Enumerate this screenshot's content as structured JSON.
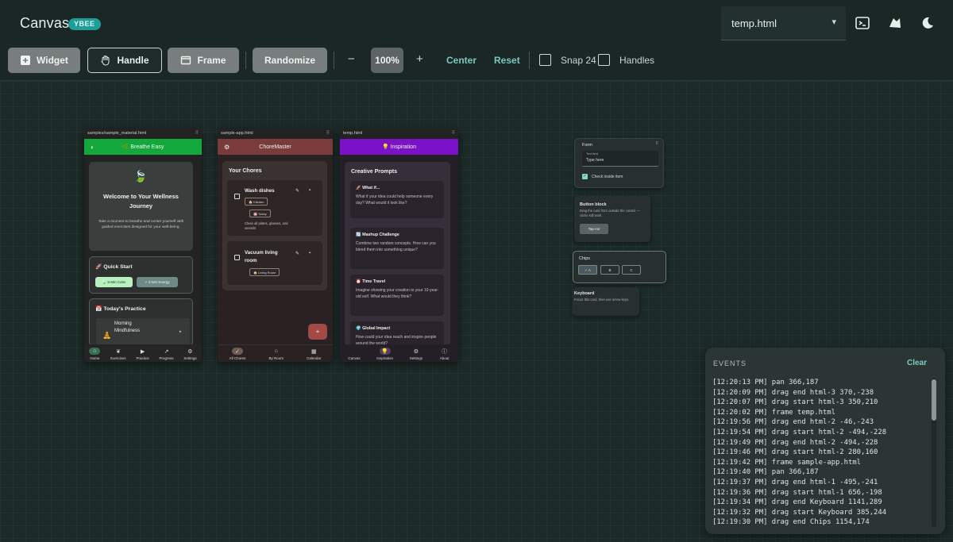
{
  "header": {
    "title": "Canvas",
    "badge": "YBEE",
    "file_select": "temp.html",
    "icons": [
      "terminal-icon",
      "shapes-icon",
      "moon-icon"
    ]
  },
  "toolbar": {
    "widget": "Widget",
    "handle": "Handle",
    "frame": "Frame",
    "randomize": "Randomize",
    "minus": "−",
    "zoom": "100%",
    "plus": "+",
    "center": "Center",
    "reset": "Reset",
    "snap": "Snap 24",
    "handles": "Handles"
  },
  "frames": {
    "wellness": {
      "file": "samples/sample_material.html",
      "appbar": "🌿 Breathe Easy",
      "welcome_title": "Welcome to Your Wellness Journey",
      "welcome_body": "Take a moment to breathe and center yourself with guided exercises designed for your well-being.",
      "quick_start": "🚀 Quick Start",
      "chip_calm": "🍃 5-Min Calm",
      "chip_energy": "⚡ 3-Min Energy",
      "practice": "📅 Today's Practice",
      "practice_item": "Morning Mindfulness",
      "nav": [
        "Home",
        "Exercises",
        "Practice",
        "Progress",
        "Settings"
      ]
    },
    "chores": {
      "file": "sample-app.html",
      "appbar": "ChoreMaster",
      "section": "Your Chores",
      "item1_title": "Wash dishes",
      "item1_chip1": "🏠 Kitchen",
      "item1_chip2": "📅 Today",
      "item1_desc": "Clean all plates, glasses, and utensils",
      "item2_title": "Vacuum living room",
      "item2_chip1": "🏠 Living Room",
      "fab": "+",
      "nav": [
        "All Chores",
        "By Room",
        "Calendar"
      ]
    },
    "inspiration": {
      "file": "temp.html",
      "appbar": "💡 Inspiration",
      "section": "Creative Prompts",
      "prompts": [
        {
          "title": "🚀 What if...",
          "body": "What if your idea could help someone every day? What would it look like?"
        },
        {
          "title": "🔄 Mashup Challenge",
          "body": "Combine two random concepts. How can you blend them into something unique?"
        },
        {
          "title": "⏰ Time Travel",
          "body": "Imagine showing your creation to your 10-year-old self. What would they think?"
        },
        {
          "title": "🌍 Global Impact",
          "body": "How could your idea reach and inspire people around the world?"
        }
      ],
      "nav": [
        "Canvas",
        "Inspiration",
        "Settings",
        "About"
      ]
    }
  },
  "widgets": {
    "form": {
      "title": "Form",
      "field_label": "Text field",
      "field_placeholder": "Type here",
      "check_label": "Check inside item"
    },
    "button_block": {
      "title": "Button block",
      "desc": "Drag the card from outside the control — clicks still work.",
      "button": "Tap me"
    },
    "chips": {
      "title": "Chips",
      "items": [
        "✓ A",
        "B",
        "C"
      ]
    },
    "keyboard": {
      "title": "Keyboard",
      "desc": "Focus this card, then use arrow keys."
    }
  },
  "events": {
    "title": "EVENTS",
    "clear": "Clear",
    "lines": [
      "[12:20:13 PM] pan 366,187",
      "[12:20:09 PM] drag end html-3 370,-238",
      "[12:20:07 PM] drag start html-3 350,210",
      "[12:20:02 PM] frame temp.html",
      "[12:19:56 PM] drag end html-2 -46,-243",
      "[12:19:54 PM] drag start html-2 -494,-228",
      "[12:19:49 PM] drag end html-2 -494,-228",
      "[12:19:46 PM] drag start html-2 280,160",
      "[12:19:42 PM] frame sample-app.html",
      "[12:19:40 PM] pan 366,187",
      "[12:19:37 PM] drag end html-1 -495,-241",
      "[12:19:36 PM] drag start html-1 656,-198",
      "[12:19:34 PM] drag end Keyboard 1141,289",
      "[12:19:32 PM] drag start Keyboard 385,244",
      "[12:19:30 PM] drag end Chips 1154,174"
    ]
  },
  "colors": {
    "accent": "#1e9e97",
    "link": "#7cc8bf",
    "wellness_bar": "#12a83c",
    "chores_bar": "#7a3b3b",
    "inspiration_bar": "#7b12c8"
  }
}
